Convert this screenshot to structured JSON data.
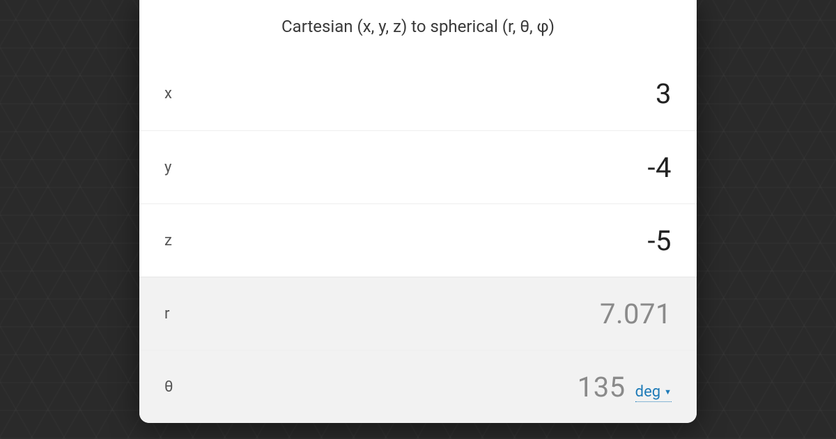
{
  "title": "Cartesian (x, y, z) to spherical (r, θ, φ)",
  "inputs": {
    "x": {
      "label": "x",
      "value": "3"
    },
    "y": {
      "label": "y",
      "value": "-4"
    },
    "z": {
      "label": "z",
      "value": "-5"
    }
  },
  "outputs": {
    "r": {
      "label": "r",
      "value": "7.071"
    },
    "theta": {
      "label": "θ",
      "value": "135",
      "unit": "deg"
    }
  }
}
